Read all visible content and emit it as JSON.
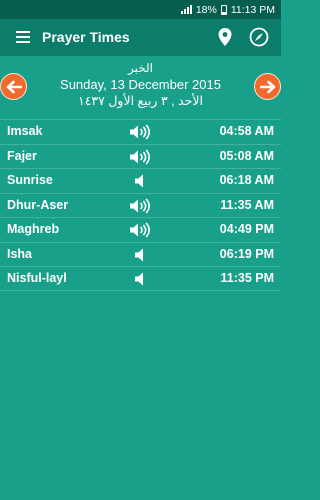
{
  "status_bar": {
    "battery": "18%",
    "time": "11:13 PM"
  },
  "app_bar": {
    "title": "Prayer Times"
  },
  "date": {
    "city": "الخبر",
    "gregorian": "Sunday, 13 December 2015",
    "hijri": "الأحد , ٣ ربيع الأول ١٤٣٧"
  },
  "prayers": [
    {
      "name": "Imsak",
      "time": "04:58 AM",
      "sound": "speaker-on-icon"
    },
    {
      "name": "Fajer",
      "time": "05:08 AM",
      "sound": "speaker-on-icon"
    },
    {
      "name": "Sunrise",
      "time": "06:18 AM",
      "sound": "speaker-off-icon"
    },
    {
      "name": "Dhur-Aser",
      "time": "11:35 AM",
      "sound": "speaker-on-icon"
    },
    {
      "name": "Maghreb",
      "time": "04:49 PM",
      "sound": "speaker-on-icon"
    },
    {
      "name": "Isha",
      "time": "06:19 PM",
      "sound": "speaker-off-icon"
    },
    {
      "name": "Nisful-layl",
      "time": "11:35 PM",
      "sound": "speaker-off-icon"
    }
  ],
  "colors": {
    "background": "#19a08a",
    "app_bar": "#0b7d6a",
    "status_bar": "#075e4e",
    "nav_button": "#f06a2e"
  }
}
